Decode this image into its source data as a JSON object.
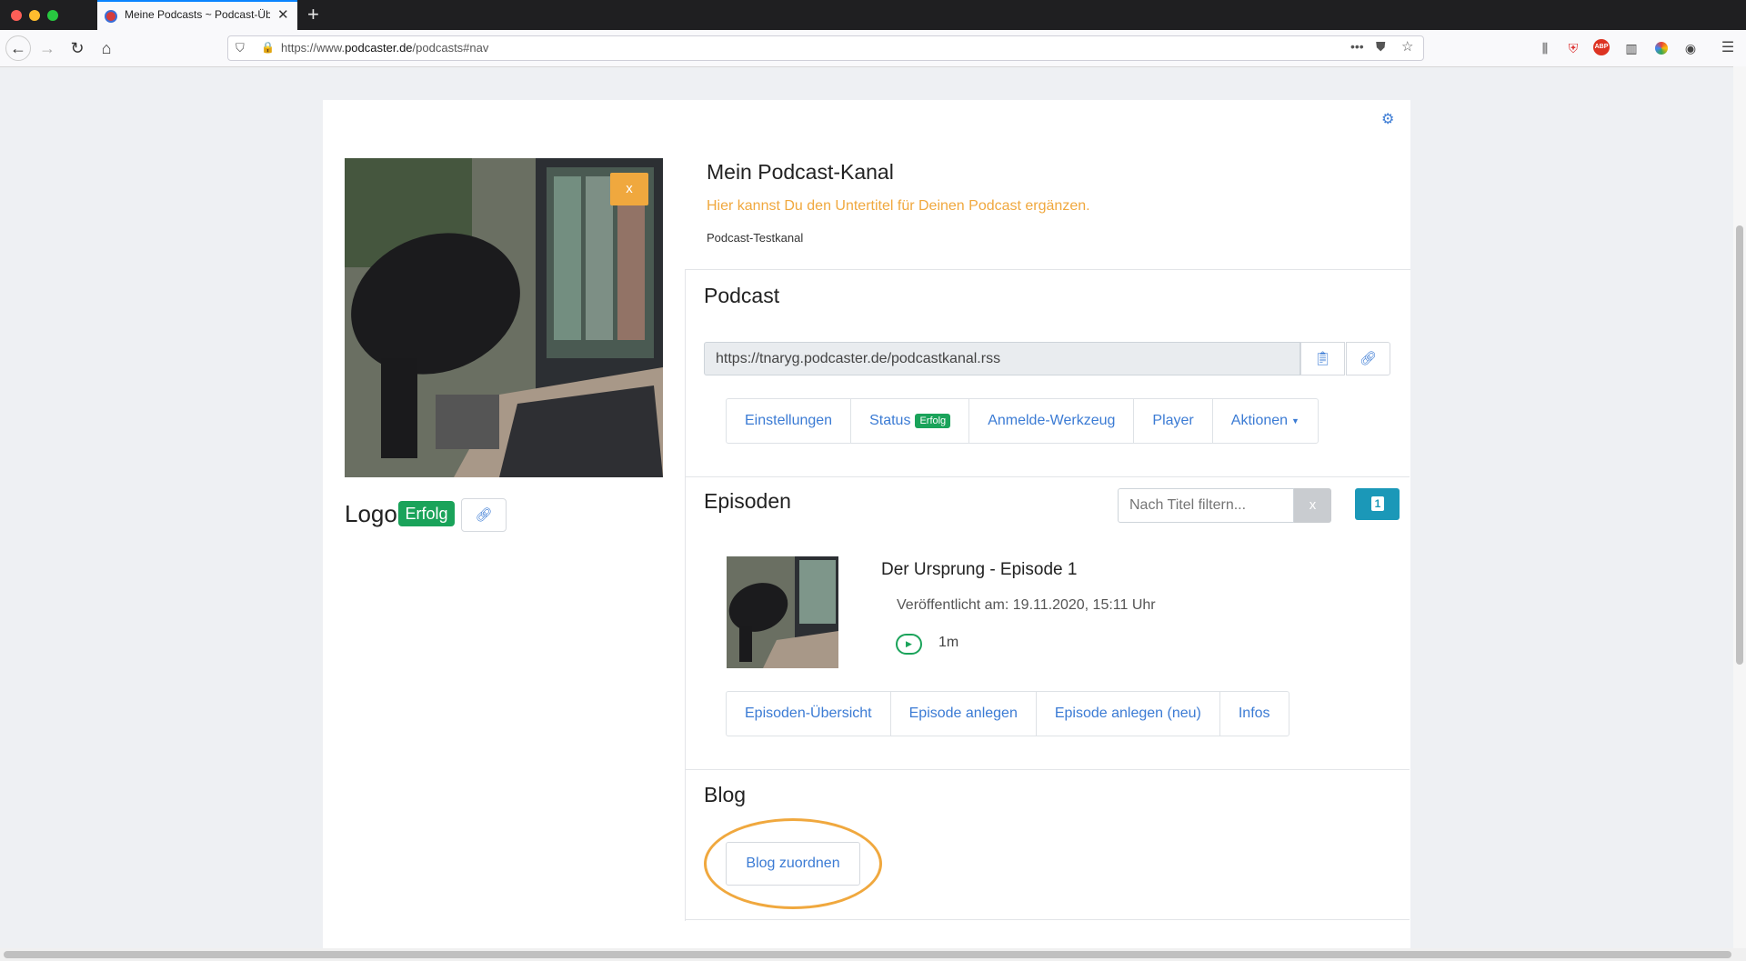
{
  "browser": {
    "tab_title": "Meine Podcasts ~ Podcast-Übe",
    "url_prefix": "https://www.",
    "url_domain": "podcaster.de",
    "url_path": "/podcasts#nav"
  },
  "channel": {
    "title": "Mein Podcast-Kanal",
    "subtitle": "Hier kannst Du den Untertitel für Deinen Podcast ergänzen.",
    "name": "Podcast-Testkanal",
    "cover_remove": "x"
  },
  "logo": {
    "label": "Logo",
    "status": "Erfolg"
  },
  "podcast": {
    "heading": "Podcast",
    "feed_url": "https://tnaryg.podcaster.de/podcastkanal.rss",
    "tabs": {
      "settings": "Einstellungen",
      "status": "Status",
      "status_badge": "Erfolg",
      "submit_tool": "Anmelde-Werkzeug",
      "player": "Player",
      "actions": "Aktionen"
    }
  },
  "episodes": {
    "heading": "Episoden",
    "filter_placeholder": "Nach Titel filtern...",
    "filter_clear": "x",
    "count": "1",
    "items": [
      {
        "title": "Der Ursprung - Episode 1",
        "published": "Veröffentlicht am: 19.11.2020, 15:11 Uhr",
        "duration": "1m"
      }
    ],
    "tabs": {
      "overview": "Episoden-Übersicht",
      "create": "Episode anlegen",
      "create_new": "Episode anlegen (neu)",
      "infos": "Infos"
    }
  },
  "blog": {
    "heading": "Blog",
    "assign_button": "Blog zuordnen"
  },
  "colors": {
    "accent_blue": "#3b7bd4",
    "success_green": "#1aa35a",
    "warning_orange": "#f0a83e",
    "info_teal": "#1b98b8"
  }
}
